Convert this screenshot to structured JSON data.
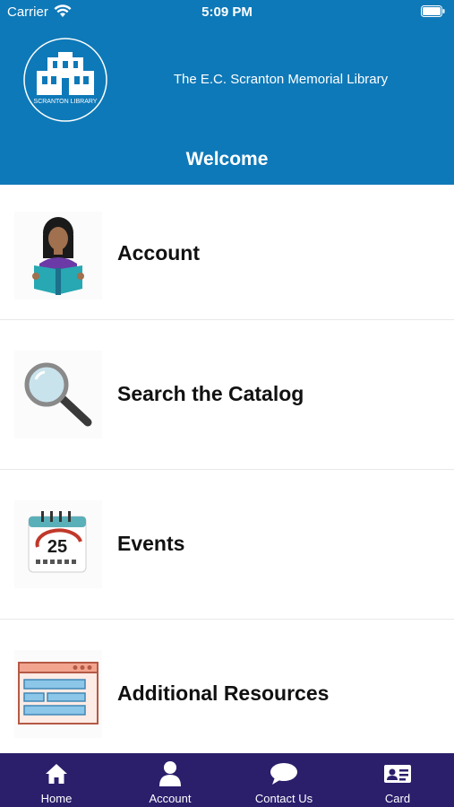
{
  "status_bar": {
    "carrier": "Carrier",
    "time": "5:09 PM"
  },
  "header": {
    "logo_text": "SCRANTON LIBRARY",
    "library_name": "The E.C. Scranton Memorial Library",
    "title": "Welcome"
  },
  "menu": [
    {
      "label": "Account",
      "icon": "person-reading-icon"
    },
    {
      "label": "Search the Catalog",
      "icon": "magnifying-glass-icon"
    },
    {
      "label": "Events",
      "icon": "calendar-icon",
      "badge": "25"
    },
    {
      "label": "Additional Resources",
      "icon": "web-browser-icon"
    }
  ],
  "tabs": [
    {
      "label": "Home",
      "icon": "home-icon"
    },
    {
      "label": "Account",
      "icon": "person-icon"
    },
    {
      "label": "Contact Us",
      "icon": "chat-bubble-icon"
    },
    {
      "label": "Card",
      "icon": "id-card-icon"
    }
  ],
  "colors": {
    "header": "#0e79b8",
    "tabbar": "#2b1e6b",
    "background": "#ffffff"
  }
}
